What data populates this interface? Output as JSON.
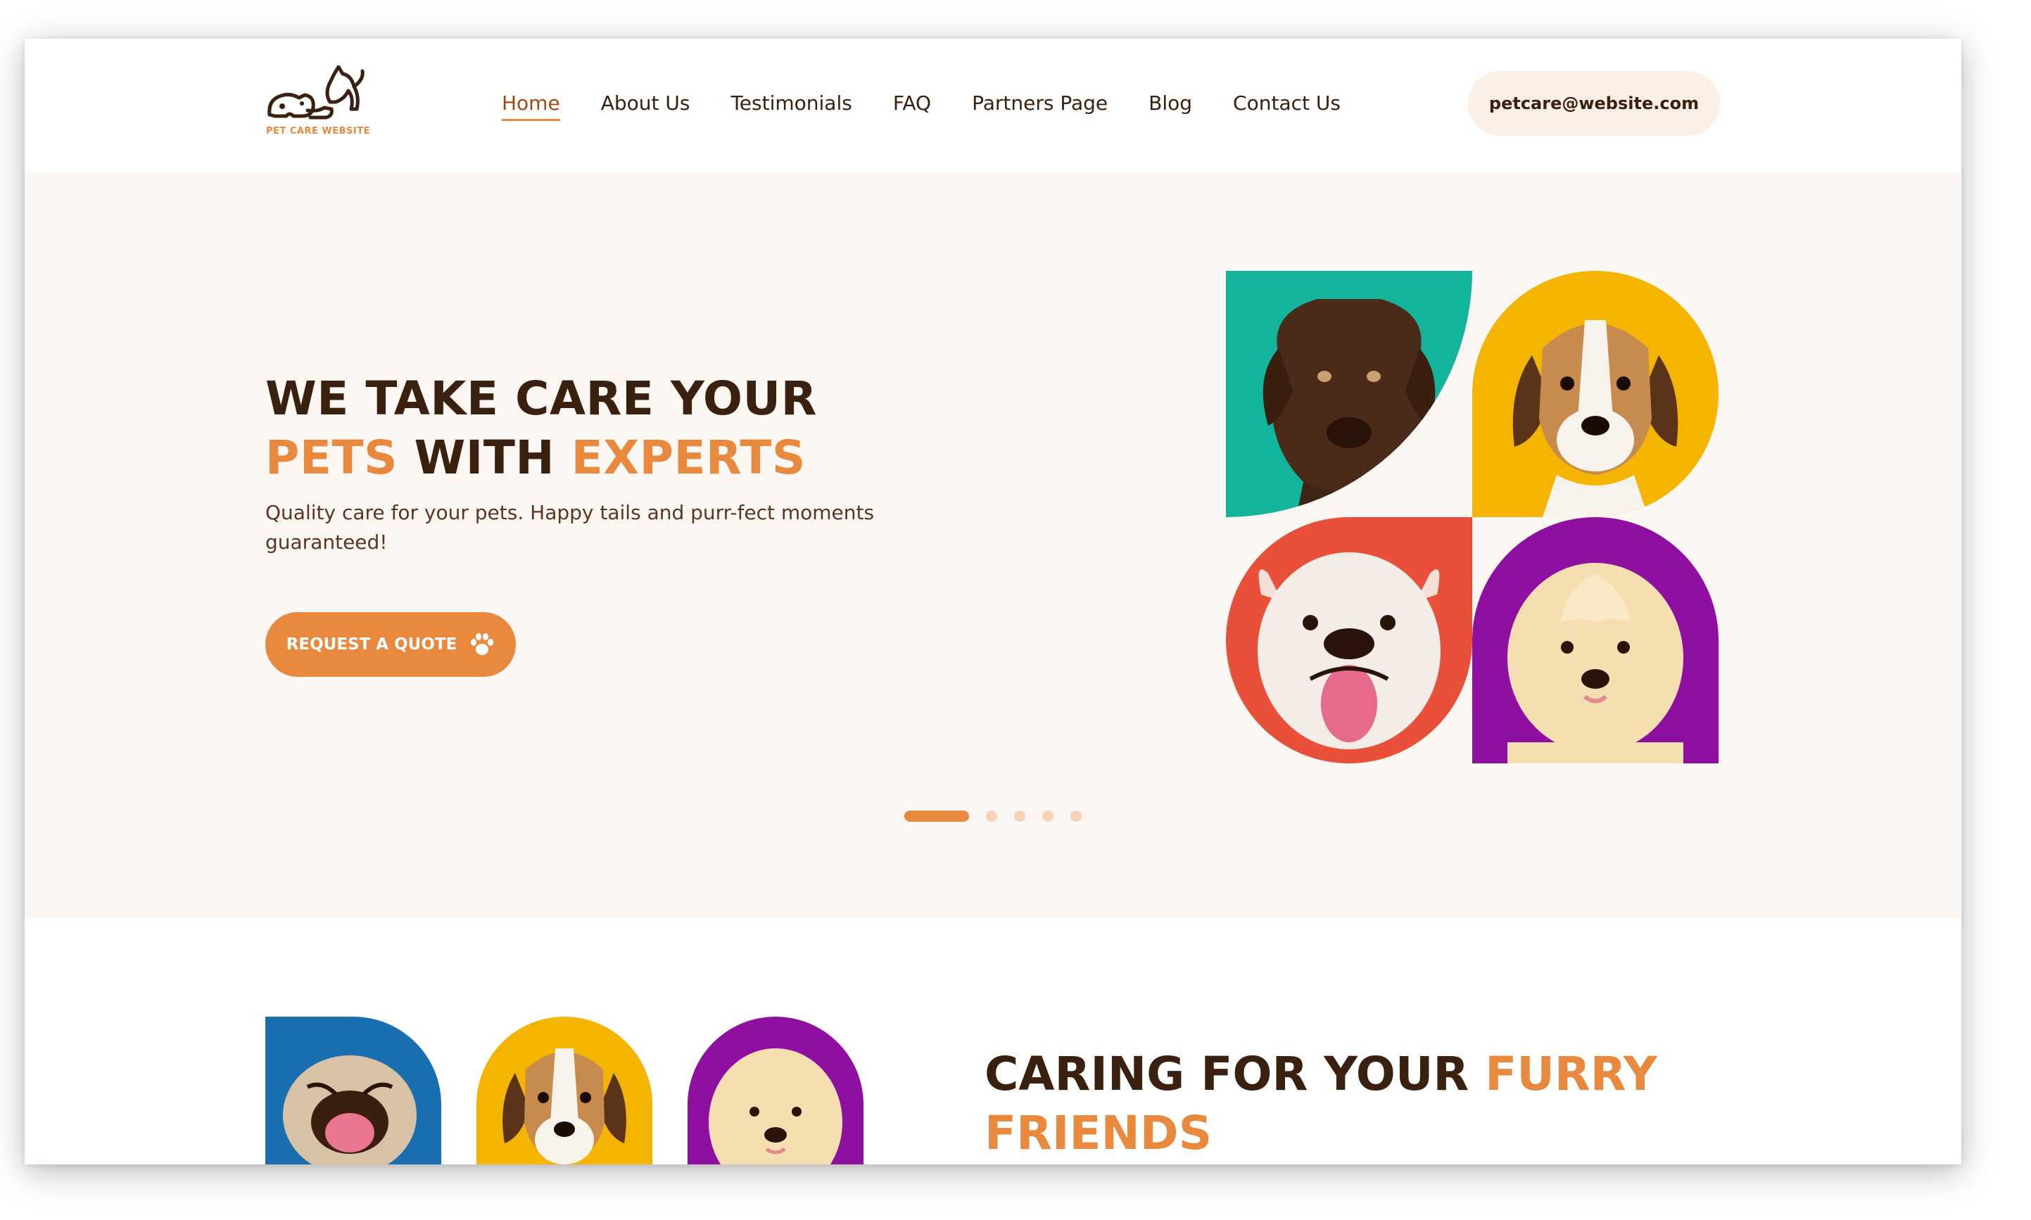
{
  "brand": {
    "logo_text": "PET CARE WEBSITE"
  },
  "nav": {
    "items": [
      {
        "label": "Home",
        "active": true
      },
      {
        "label": "About Us"
      },
      {
        "label": "Testimonials"
      },
      {
        "label": "FAQ"
      },
      {
        "label": "Partners Page"
      },
      {
        "label": "Blog"
      },
      {
        "label": "Contact Us"
      }
    ]
  },
  "header": {
    "email": "petcare@website.com"
  },
  "hero": {
    "title_line1": "WE TAKE CARE YOUR",
    "title_line2_a": "PETS",
    "title_line2_b": "WITH",
    "title_line2_c": "EXPERTS",
    "subtitle": "Quality care for your pets. Happy tails and purr-fect moments guaranteed!",
    "cta_label": "REQUEST A QUOTE",
    "cta_icon": "paw-icon",
    "carousel_slides": 5,
    "carousel_active": 1
  },
  "section2": {
    "title_a": "CARING FOR YOUR",
    "title_b": "FURRY",
    "title_c": "FRIENDS"
  },
  "colors": {
    "accent": "#e8893e",
    "dark_text": "#3a200f",
    "hero_bg": "#fdf7f3",
    "tile_teal": "#13b39c",
    "tile_yellow": "#f4b400",
    "tile_red": "#e8503a",
    "tile_purple": "#8e0fa0",
    "tile_blue": "#1a6fb0"
  },
  "images": {
    "hero_tiles": [
      "chocolate-labrador-puppy",
      "beagle-puppy",
      "bulldog-puppy",
      "golden-retriever-puppy"
    ],
    "lower_tiles": [
      "pug-puppy",
      "beagle-puppy",
      "golden-retriever-puppy"
    ]
  }
}
